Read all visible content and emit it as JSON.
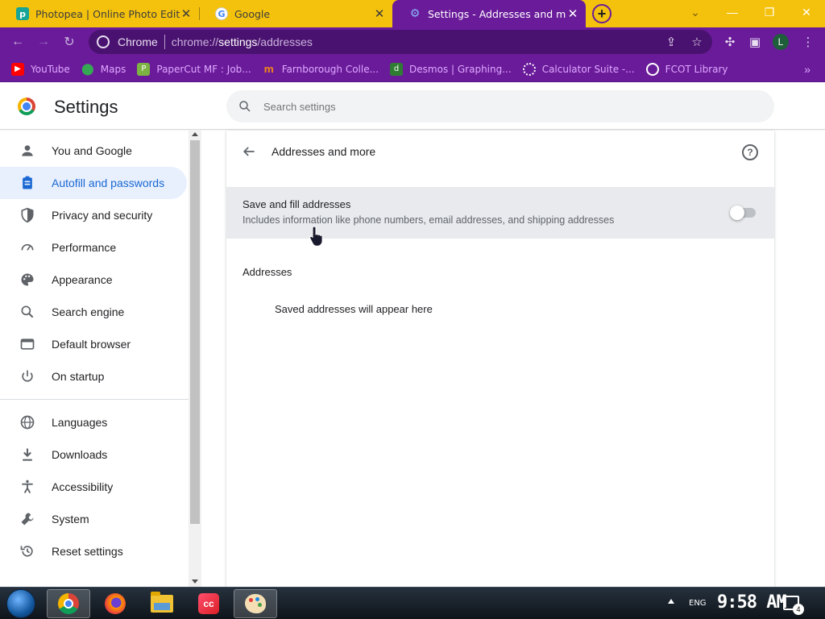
{
  "tabs": [
    {
      "title": "Photopea | Online Photo Editor",
      "favicon": "photopea-icon",
      "active": false
    },
    {
      "title": "Google",
      "favicon": "google-icon",
      "active": false
    },
    {
      "title": "Settings - Addresses and more",
      "favicon": "settings-gear-icon",
      "active": true
    }
  ],
  "omnibox": {
    "chip": "Chrome",
    "url_prefix": "chrome://",
    "url_host": "settings",
    "url_path": "/addresses"
  },
  "profile_initial": "L",
  "bookmarks": [
    {
      "label": "YouTube",
      "icon": "youtube-icon",
      "color": "#ff0000"
    },
    {
      "label": "Maps",
      "icon": "maps-icon",
      "color": "#34a853"
    },
    {
      "label": "PaperCut MF : Job...",
      "icon": "papercut-icon",
      "color": "#7cb342"
    },
    {
      "label": "Farnborough Colle...",
      "icon": "farnborough-icon",
      "color": "#e67e22"
    },
    {
      "label": "Desmos | Graphing...",
      "icon": "desmos-icon",
      "color": "#2e7d32"
    },
    {
      "label": "Calculator Suite -...",
      "icon": "calculator-icon",
      "color": "#ffffff"
    },
    {
      "label": "FCOT Library",
      "icon": "globe-icon",
      "color": "#ffffff"
    }
  ],
  "header": {
    "title": "Settings",
    "search_placeholder": "Search settings"
  },
  "sidebar": {
    "items": [
      {
        "label": "You and Google",
        "icon": "person-icon",
        "active": false
      },
      {
        "label": "Autofill and passwords",
        "icon": "clipboard-icon",
        "active": true
      },
      {
        "label": "Privacy and security",
        "icon": "shield-icon",
        "active": false
      },
      {
        "label": "Performance",
        "icon": "speedometer-icon",
        "active": false
      },
      {
        "label": "Appearance",
        "icon": "palette-icon",
        "active": false
      },
      {
        "label": "Search engine",
        "icon": "search-icon",
        "active": false
      },
      {
        "label": "Default browser",
        "icon": "browser-icon",
        "active": false
      },
      {
        "label": "On startup",
        "icon": "power-icon",
        "active": false
      }
    ],
    "items2": [
      {
        "label": "Languages",
        "icon": "globe-icon"
      },
      {
        "label": "Downloads",
        "icon": "download-icon"
      },
      {
        "label": "Accessibility",
        "icon": "accessibility-icon"
      },
      {
        "label": "System",
        "icon": "wrench-icon"
      },
      {
        "label": "Reset settings",
        "icon": "reset-icon"
      }
    ]
  },
  "main": {
    "title": "Addresses and more",
    "toggle": {
      "label": "Save and fill addresses",
      "description": "Includes information like phone numbers, email addresses, and shipping addresses",
      "enabled": false
    },
    "section_title": "Addresses",
    "empty_message": "Saved addresses will appear here"
  },
  "taskbar": {
    "language": "ENG",
    "time": "9:58 AM",
    "notification_count": "4"
  },
  "colors": {
    "accent": "#1967d2",
    "theme_purple": "#6a1b9a",
    "tab_strip": "#f4c20d"
  }
}
